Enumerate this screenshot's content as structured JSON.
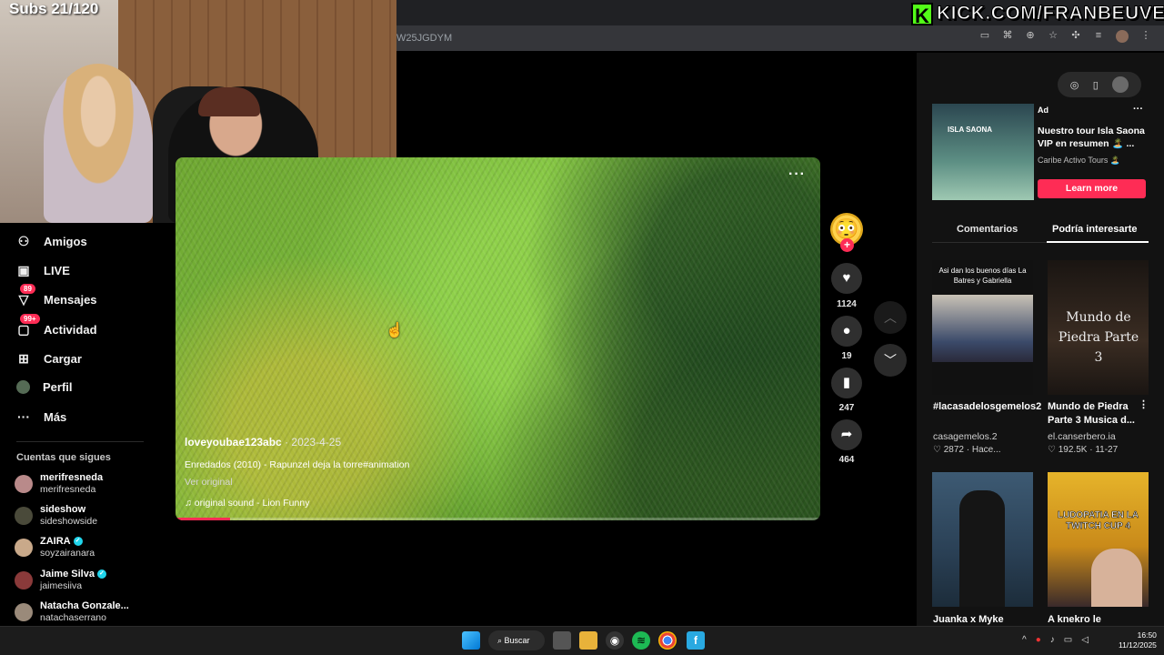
{
  "overlay": {
    "subs_label": "Subs 21/120",
    "kick_logo": "K",
    "kick_url": "KICK.COM/FRANBEUVE"
  },
  "browser": {
    "address_text": "W25JGDYM",
    "toolbar_icons": [
      "cast-icon",
      "translate-icon",
      "zoom-icon",
      "bookmark-star-icon",
      "extensions-icon",
      "media-controls-icon",
      "profile-avatar",
      "kebab-menu-icon"
    ]
  },
  "sidebar": {
    "items": [
      {
        "label": "Amigos",
        "icon": "friends-icon",
        "badge": ""
      },
      {
        "label": "LIVE",
        "icon": "live-icon",
        "badge": ""
      },
      {
        "label": "Mensajes",
        "icon": "messages-icon",
        "badge": "89"
      },
      {
        "label": "Actividad",
        "icon": "activity-icon",
        "badge": "99+"
      },
      {
        "label": "Cargar",
        "icon": "upload-icon",
        "badge": ""
      },
      {
        "label": "Perfil",
        "icon": "profile-icon",
        "badge": ""
      },
      {
        "label": "Más",
        "icon": "more-icon",
        "badge": ""
      }
    ],
    "following_title": "Cuentas que sigues",
    "following": [
      {
        "name": "merifresneda",
        "user": "merifresneda",
        "verified": false
      },
      {
        "name": "sideshow",
        "user": "sideshowside",
        "verified": false
      },
      {
        "name": "ZAIRA",
        "user": "soyzairanara",
        "verified": true
      },
      {
        "name": "Jaime Silva",
        "user": "jaimesiiva",
        "verified": true
      },
      {
        "name": "Natacha Gonzale...",
        "user": "natachaserrano",
        "verified": false
      }
    ]
  },
  "video": {
    "more": "···",
    "author": "loveyoubae123abc",
    "date": "· 2023-4-25",
    "description": "Enredados (2010) - Rapunzel deja la torre#animation",
    "see_more": "Ver original",
    "sound": "♫  original sound - Lion Funny",
    "progress": 0.085
  },
  "actions": {
    "like_count": "1124",
    "comment_count": "19",
    "save_count": "247",
    "share_count": "464"
  },
  "right_panel": {
    "ad": {
      "label": "Ad",
      "thumb_text": "ISLA SAONA",
      "title": "Nuestro tour Isla Saona VIP en resumen 🏝️ ...",
      "advertiser": "Caribe Activo Tours 🏝️",
      "cta": "Learn more"
    },
    "tabs": [
      "Comentarios",
      "Podría interesarte"
    ],
    "active_tab": "Podría interesarte",
    "cards": [
      {
        "thumb_caption": "Asi dan los buenos días La Batres y Gabriella",
        "title": "#lacasadelosgemelos2",
        "user": "casagemelos.2",
        "stats": "♡ 2872 · Hace..."
      },
      {
        "thumb_caption": "Mundo de Piedra Parte 3",
        "title": "Mundo de Piedra Parte 3 Musica d...",
        "user": "el.canserbero.ia",
        "stats": "♡ 192.5K · 11-27"
      },
      {
        "thumb_caption": "",
        "title": "Juanka x Myke",
        "user": "",
        "stats": ""
      },
      {
        "thumb_caption": "LUDOPATIA EN LA TWITCH CUP 4",
        "title": "A knekro le",
        "user": "",
        "stats": ""
      }
    ]
  },
  "taskbar": {
    "search_label": "Buscar",
    "time": "16:50",
    "date": "11/12/2025"
  }
}
